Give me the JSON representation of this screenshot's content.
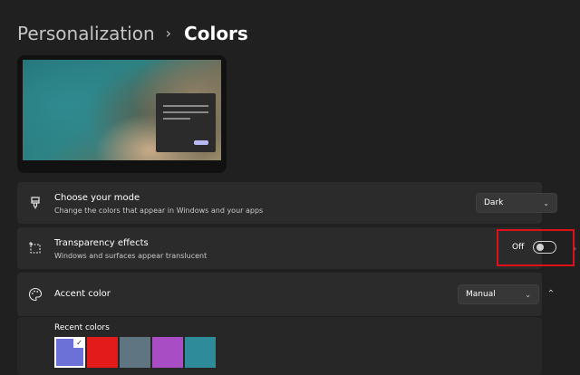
{
  "breadcrumb": {
    "parent": "Personalization",
    "separator": "›",
    "current": "Colors"
  },
  "mode": {
    "title": "Choose your mode",
    "description": "Change the colors that appear in Windows and your apps",
    "value": "Dark",
    "icon": "brush-icon"
  },
  "transparency": {
    "title": "Transparency effects",
    "description": "Windows and surfaces appear translucent",
    "state_label": "Off",
    "enabled": false,
    "icon": "transparency-icon"
  },
  "accent": {
    "title": "Accent color",
    "value": "Manual",
    "icon": "palette-icon",
    "expanded": true
  },
  "recent": {
    "label": "Recent colors",
    "colors": [
      "#6c71d8",
      "#e31b1b",
      "#5f7582",
      "#a84dc4",
      "#2e8b99"
    ],
    "selected_index": 0
  },
  "colors": {
    "background": "#202020",
    "card": "#2b2b2b",
    "highlight": "#e0101a"
  }
}
